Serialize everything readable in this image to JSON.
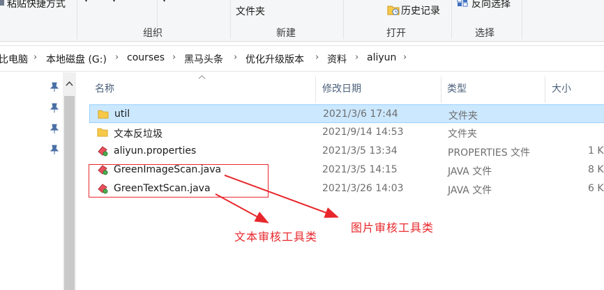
{
  "ribbon": {
    "top_left_label": "粘贴快捷方式",
    "new_folder_label": "文件夹",
    "history_label": "历史记录",
    "invert_selection_label": "反向选择",
    "groups": [
      "组织",
      "新建",
      "打开",
      "选择"
    ]
  },
  "breadcrumb": [
    "比电脑",
    "本地磁盘 (G:)",
    "courses",
    "黑马头条",
    "优化升级版本",
    "资料",
    "aliyun"
  ],
  "columns": {
    "name": "名称",
    "modified": "修改日期",
    "type": "类型",
    "size": "大小"
  },
  "files": [
    {
      "name": "util",
      "modified": "2021/3/6 17:44",
      "type": "文件夹",
      "size": "",
      "icon": "folder-icon",
      "selected": true
    },
    {
      "name": "文本反垃圾",
      "modified": "2021/9/14 14:53",
      "type": "文件夹",
      "size": "",
      "icon": "folder-icon",
      "selected": false
    },
    {
      "name": "aliyun.properties",
      "modified": "2021/3/5 13:34",
      "type": "PROPERTIES 文件",
      "size": "1 K",
      "icon": "properties-file-icon",
      "selected": false
    },
    {
      "name": "GreenImageScan.java",
      "modified": "2021/3/5 14:15",
      "type": "JAVA 文件",
      "size": "8 K",
      "icon": "java-file-icon",
      "selected": false
    },
    {
      "name": "GreenTextScan.java",
      "modified": "2021/3/26 14:03",
      "type": "JAVA 文件",
      "size": "6 K",
      "icon": "java-file-icon",
      "selected": false
    }
  ],
  "annotations": {
    "text_scan_label": "文本审核工具类",
    "image_scan_label": "图片审核工具类",
    "color": "#e8272c"
  },
  "colors": {
    "selection_bg": "#cce8ff",
    "selection_border": "#99d1ff",
    "folder": "#f7c948",
    "header_text": "#4c607a"
  }
}
